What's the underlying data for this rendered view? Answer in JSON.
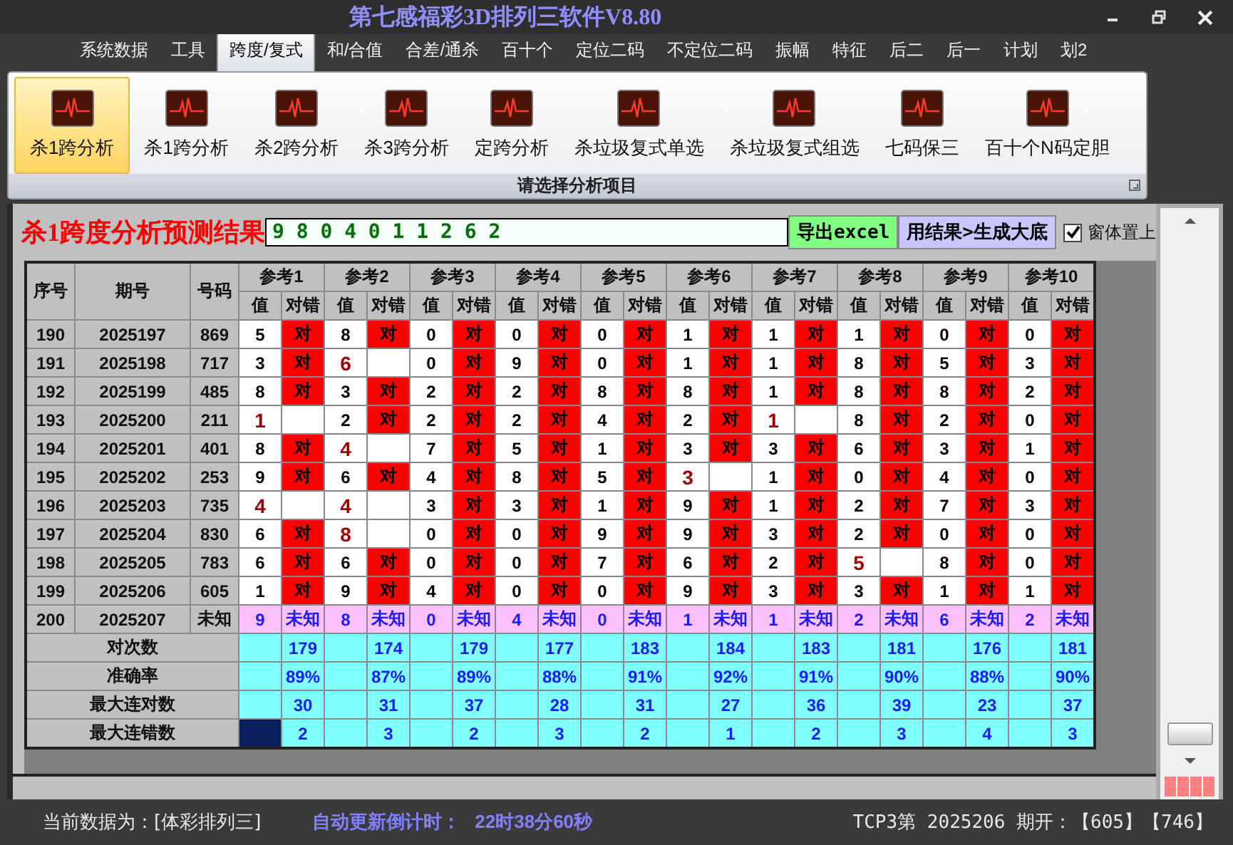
{
  "window": {
    "title": "第七感福彩3D排列三软件V8.80"
  },
  "menu_tabs": [
    {
      "label": "系统数据",
      "selected": false
    },
    {
      "label": "工具",
      "selected": false
    },
    {
      "label": "跨度/复式",
      "selected": true
    },
    {
      "label": "和/合值",
      "selected": false
    },
    {
      "label": "合差/通杀",
      "selected": false
    },
    {
      "label": "百十个",
      "selected": false
    },
    {
      "label": "定位二码",
      "selected": false
    },
    {
      "label": "不定位二码",
      "selected": false
    },
    {
      "label": "振幅",
      "selected": false
    },
    {
      "label": "特征",
      "selected": false
    },
    {
      "label": "后二",
      "selected": false
    },
    {
      "label": "后一",
      "selected": false
    },
    {
      "label": "计划",
      "selected": false
    },
    {
      "label": "划2",
      "selected": false
    }
  ],
  "ribbon": {
    "buttons": [
      {
        "label": "杀1跨分析",
        "selected": true
      },
      {
        "label": "杀1跨分析",
        "selected": false
      },
      {
        "label": "杀2跨分析",
        "selected": false
      },
      {
        "label": "杀3跨分析",
        "selected": false
      },
      {
        "label": "定跨分析",
        "selected": false
      },
      {
        "label": "杀垃圾复式单选",
        "selected": false
      },
      {
        "label": "杀垃圾复式组选",
        "selected": false
      },
      {
        "label": "七码保三",
        "selected": false
      },
      {
        "label": "百十个N码定胆",
        "selected": false
      }
    ],
    "group_label": "请选择分析项目"
  },
  "result": {
    "label": "杀1跨度分析预测结果",
    "value": "9 8 0 4 0 1 1 2 6 2"
  },
  "buttons": [
    {
      "label": "导出excel",
      "kind": "export"
    },
    {
      "label": "用结果>生成大底",
      "kind": "generate"
    }
  ],
  "stay_on_top": {
    "label": "窗体置上",
    "checked": true
  },
  "table": {
    "columns": [
      "序号",
      "期号",
      "号码"
    ],
    "ref_groups": [
      {
        "label": "参考1",
        "value_label": "值",
        "result_label": "对错"
      },
      {
        "label": "参考2",
        "value_label": "值",
        "result_label": "对错"
      },
      {
        "label": "参考3",
        "value_label": "值",
        "result_label": "对错"
      },
      {
        "label": "参考4",
        "value_label": "值",
        "result_label": "对错"
      },
      {
        "label": "参考5",
        "value_label": "值",
        "result_label": "对错"
      },
      {
        "label": "参考6",
        "value_label": "值",
        "result_label": "对错"
      },
      {
        "label": "参考7",
        "value_label": "值",
        "result_label": "对错"
      },
      {
        "label": "参考8",
        "value_label": "值",
        "result_label": "对错"
      },
      {
        "label": "参考9",
        "value_label": "值",
        "result_label": "对错"
      },
      {
        "label": "参考10",
        "value_label": "值",
        "result_label": "对错"
      }
    ],
    "rows": [
      {
        "kind": "history",
        "seq": "190",
        "issue": "2025197",
        "number": "869",
        "cells": [
          {
            "value": "5",
            "result": "对",
            "hit": true
          },
          {
            "value": "8",
            "result": "对",
            "hit": true
          },
          {
            "value": "0",
            "result": "对",
            "hit": true
          },
          {
            "value": "0",
            "result": "对",
            "hit": true
          },
          {
            "value": "0",
            "result": "对",
            "hit": true
          },
          {
            "value": "1",
            "result": "对",
            "hit": true
          },
          {
            "value": "1",
            "result": "对",
            "hit": true
          },
          {
            "value": "1",
            "result": "对",
            "hit": true
          },
          {
            "value": "0",
            "result": "对",
            "hit": true
          },
          {
            "value": "0",
            "result": "对",
            "hit": true
          }
        ]
      },
      {
        "kind": "history",
        "seq": "191",
        "issue": "2025198",
        "number": "717",
        "cells": [
          {
            "value": "3",
            "result": "对",
            "hit": true
          },
          {
            "value": "6",
            "hit": false
          },
          {
            "value": "0",
            "result": "对",
            "hit": true
          },
          {
            "value": "9",
            "result": "对",
            "hit": true
          },
          {
            "value": "0",
            "result": "对",
            "hit": true
          },
          {
            "value": "1",
            "result": "对",
            "hit": true
          },
          {
            "value": "1",
            "result": "对",
            "hit": true
          },
          {
            "value": "8",
            "result": "对",
            "hit": true
          },
          {
            "value": "5",
            "result": "对",
            "hit": true
          },
          {
            "value": "3",
            "result": "对",
            "hit": true
          }
        ]
      },
      {
        "kind": "history",
        "seq": "192",
        "issue": "2025199",
        "number": "485",
        "cells": [
          {
            "value": "8",
            "result": "对",
            "hit": true
          },
          {
            "value": "3",
            "result": "对",
            "hit": true
          },
          {
            "value": "2",
            "result": "对",
            "hit": true
          },
          {
            "value": "2",
            "result": "对",
            "hit": true
          },
          {
            "value": "8",
            "result": "对",
            "hit": true
          },
          {
            "value": "8",
            "result": "对",
            "hit": true
          },
          {
            "value": "1",
            "result": "对",
            "hit": true
          },
          {
            "value": "8",
            "result": "对",
            "hit": true
          },
          {
            "value": "8",
            "result": "对",
            "hit": true
          },
          {
            "value": "2",
            "result": "对",
            "hit": true
          }
        ]
      },
      {
        "kind": "history",
        "seq": "193",
        "issue": "2025200",
        "number": "211",
        "cells": [
          {
            "value": "1",
            "hit": false
          },
          {
            "value": "2",
            "result": "对",
            "hit": true
          },
          {
            "value": "2",
            "result": "对",
            "hit": true
          },
          {
            "value": "2",
            "result": "对",
            "hit": true
          },
          {
            "value": "4",
            "result": "对",
            "hit": true
          },
          {
            "value": "2",
            "result": "对",
            "hit": true
          },
          {
            "value": "1",
            "hit": false
          },
          {
            "value": "8",
            "result": "对",
            "hit": true
          },
          {
            "value": "2",
            "result": "对",
            "hit": true
          },
          {
            "value": "0",
            "result": "对",
            "hit": true
          }
        ]
      },
      {
        "kind": "history",
        "seq": "194",
        "issue": "2025201",
        "number": "401",
        "cells": [
          {
            "value": "8",
            "result": "对",
            "hit": true
          },
          {
            "value": "4",
            "hit": false
          },
          {
            "value": "7",
            "result": "对",
            "hit": true
          },
          {
            "value": "5",
            "result": "对",
            "hit": true
          },
          {
            "value": "1",
            "result": "对",
            "hit": true
          },
          {
            "value": "3",
            "result": "对",
            "hit": true
          },
          {
            "value": "3",
            "result": "对",
            "hit": true
          },
          {
            "value": "6",
            "result": "对",
            "hit": true
          },
          {
            "value": "3",
            "result": "对",
            "hit": true
          },
          {
            "value": "1",
            "result": "对",
            "hit": true
          }
        ]
      },
      {
        "kind": "history",
        "seq": "195",
        "issue": "2025202",
        "number": "253",
        "cells": [
          {
            "value": "9",
            "result": "对",
            "hit": true
          },
          {
            "value": "6",
            "result": "对",
            "hit": true
          },
          {
            "value": "4",
            "result": "对",
            "hit": true
          },
          {
            "value": "8",
            "result": "对",
            "hit": true
          },
          {
            "value": "5",
            "result": "对",
            "hit": true
          },
          {
            "value": "3",
            "hit": false
          },
          {
            "value": "1",
            "result": "对",
            "hit": true
          },
          {
            "value": "0",
            "result": "对",
            "hit": true
          },
          {
            "value": "4",
            "result": "对",
            "hit": true
          },
          {
            "value": "0",
            "result": "对",
            "hit": true
          }
        ]
      },
      {
        "kind": "history",
        "seq": "196",
        "issue": "2025203",
        "number": "735",
        "cells": [
          {
            "value": "4",
            "hit": false
          },
          {
            "value": "4",
            "hit": false
          },
          {
            "value": "3",
            "result": "对",
            "hit": true
          },
          {
            "value": "3",
            "result": "对",
            "hit": true
          },
          {
            "value": "1",
            "result": "对",
            "hit": true
          },
          {
            "value": "9",
            "result": "对",
            "hit": true
          },
          {
            "value": "1",
            "result": "对",
            "hit": true
          },
          {
            "value": "2",
            "result": "对",
            "hit": true
          },
          {
            "value": "7",
            "result": "对",
            "hit": true
          },
          {
            "value": "3",
            "result": "对",
            "hit": true
          }
        ]
      },
      {
        "kind": "history",
        "seq": "197",
        "issue": "2025204",
        "number": "830",
        "cells": [
          {
            "value": "6",
            "result": "对",
            "hit": true
          },
          {
            "value": "8",
            "hit": false
          },
          {
            "value": "0",
            "result": "对",
            "hit": true
          },
          {
            "value": "0",
            "result": "对",
            "hit": true
          },
          {
            "value": "9",
            "result": "对",
            "hit": true
          },
          {
            "value": "9",
            "result": "对",
            "hit": true
          },
          {
            "value": "3",
            "result": "对",
            "hit": true
          },
          {
            "value": "2",
            "result": "对",
            "hit": true
          },
          {
            "value": "0",
            "result": "对",
            "hit": true
          },
          {
            "value": "0",
            "result": "对",
            "hit": true
          }
        ]
      },
      {
        "kind": "history",
        "seq": "198",
        "issue": "2025205",
        "number": "783",
        "cells": [
          {
            "value": "6",
            "result": "对",
            "hit": true
          },
          {
            "value": "6",
            "result": "对",
            "hit": true
          },
          {
            "value": "0",
            "result": "对",
            "hit": true
          },
          {
            "value": "0",
            "result": "对",
            "hit": true
          },
          {
            "value": "7",
            "result": "对",
            "hit": true
          },
          {
            "value": "6",
            "result": "对",
            "hit": true
          },
          {
            "value": "2",
            "result": "对",
            "hit": true
          },
          {
            "value": "5",
            "hit": false
          },
          {
            "value": "8",
            "result": "对",
            "hit": true
          },
          {
            "value": "0",
            "result": "对",
            "hit": true
          }
        ]
      },
      {
        "kind": "history",
        "seq": "199",
        "issue": "2025206",
        "number": "605",
        "cells": [
          {
            "value": "1",
            "result": "对",
            "hit": true
          },
          {
            "value": "9",
            "result": "对",
            "hit": true
          },
          {
            "value": "4",
            "result": "对",
            "hit": true
          },
          {
            "value": "0",
            "result": "对",
            "hit": true
          },
          {
            "value": "0",
            "result": "对",
            "hit": true
          },
          {
            "value": "9",
            "result": "对",
            "hit": true
          },
          {
            "value": "3",
            "result": "对",
            "hit": true
          },
          {
            "value": "3",
            "result": "对",
            "hit": true
          },
          {
            "value": "1",
            "result": "对",
            "hit": true
          },
          {
            "value": "1",
            "result": "对",
            "hit": true
          }
        ]
      },
      {
        "kind": "pending",
        "seq": "200",
        "issue": "2025207",
        "number": "未知",
        "cells": [
          {
            "value": "9",
            "result": "未知"
          },
          {
            "value": "8",
            "result": "未知"
          },
          {
            "value": "0",
            "result": "未知"
          },
          {
            "value": "4",
            "result": "未知"
          },
          {
            "value": "0",
            "result": "未知"
          },
          {
            "value": "1",
            "result": "未知"
          },
          {
            "value": "1",
            "result": "未知"
          },
          {
            "value": "2",
            "result": "未知"
          },
          {
            "value": "6",
            "result": "未知"
          },
          {
            "value": "2",
            "result": "未知"
          }
        ]
      }
    ],
    "stats": [
      {
        "label": "对次数",
        "focused": false,
        "values": [
          "179",
          "174",
          "179",
          "177",
          "183",
          "184",
          "183",
          "181",
          "176",
          "181"
        ]
      },
      {
        "label": "准确率",
        "focused": false,
        "values": [
          "89%",
          "87%",
          "89%",
          "88%",
          "91%",
          "92%",
          "91%",
          "90%",
          "88%",
          "90%"
        ]
      },
      {
        "label": "最大连对数",
        "focused": false,
        "values": [
          "30",
          "31",
          "37",
          "28",
          "31",
          "27",
          "36",
          "39",
          "23",
          "37"
        ]
      },
      {
        "label": "最大连错数",
        "focused": true,
        "values": [
          "2",
          "3",
          "2",
          "3",
          "2",
          "1",
          "2",
          "3",
          "4",
          "3"
        ]
      }
    ]
  },
  "status_bar": {
    "data_source": "当前数据为：[体彩排列三]",
    "countdown_label": "自动更新倒计时：",
    "countdown": "22时38分60秒",
    "latest": "TCP3第 2025206 期开：【605】【746】"
  }
}
